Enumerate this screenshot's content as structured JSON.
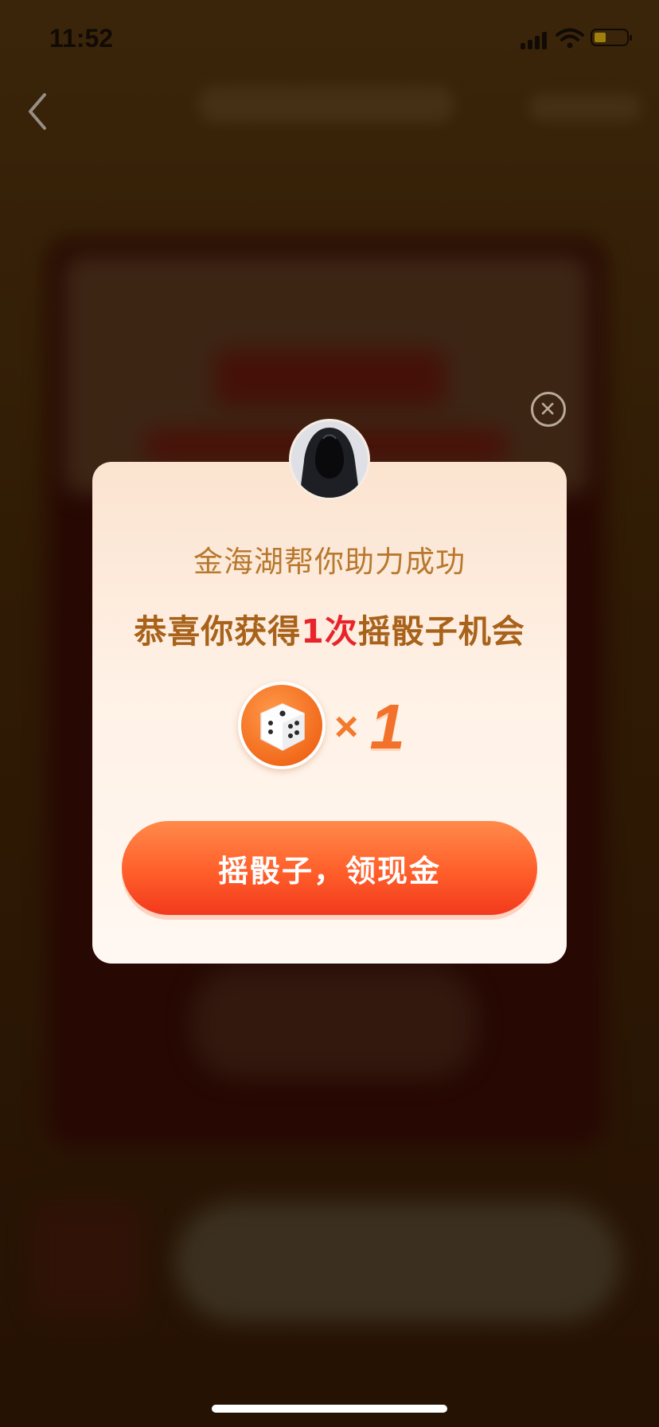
{
  "status_bar": {
    "time": "11:52"
  },
  "modal": {
    "helper_message": "金海湖帮你助力成功",
    "reward_prefix": "恭喜你获得",
    "reward_count_text": "1次",
    "reward_suffix": "摇骰子机会",
    "multiplier_symbol": "×",
    "multiplier_value": "1",
    "cta_label": "摇骰子，领现金"
  },
  "icons": {
    "back": "chevron-left-icon",
    "close": "close-circle-icon",
    "dice": "dice-icon",
    "avatar": "hooded-figure-avatar"
  },
  "colors": {
    "helper_text": "#b8782e",
    "reward_text": "#a8621a",
    "reward_highlight": "#e8242b",
    "cta_gradient_top": "#ff8a4a",
    "cta_gradient_bottom": "#f2391d",
    "dice_circle": "#f26a1c"
  }
}
